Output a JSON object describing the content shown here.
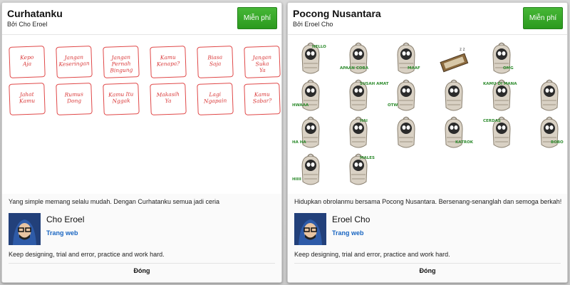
{
  "colors": {
    "accent_green": "#2fa022",
    "link_blue": "#1a66c2",
    "sticker_red": "#d93636",
    "pocong_green": "#2d8b2d"
  },
  "left": {
    "title": "Curhatanku",
    "by": "Bởi Cho Eroel",
    "button": "Miễn phí",
    "stickers": [
      "Kepo\nAja",
      "Jangan\nKeseringan",
      "Jangan\nPernah\nBingung",
      "Kamu\nKenapa?",
      "Biasa\nSaja",
      "Jangan\nSuka\nYa",
      "Jahat\nKamu",
      "Rumus\nDong",
      "Kamu Itu\nNggak",
      "Makasih\nYa",
      "Lagi\nNgapain",
      "Kamu\nSabar?"
    ],
    "description": "Yang simple memang selalu mudah. Dengan Curhatanku semua jadi ceria",
    "author": "Cho Eroel",
    "web": "Trang web",
    "motto": "Keep designing, trial and error, practice and work hard.",
    "close": "Đóng"
  },
  "right": {
    "title": "Pocong Nusantara",
    "by": "Bởi Eroel Cho",
    "button": "Miễn phí",
    "stickers": [
      "HELLO",
      "APAAN COBA",
      "MAAF",
      "",
      "OMG",
      "HWAAA",
      "SUSAH AMAT",
      "OTW",
      "",
      "KAMU DI MANA",
      "",
      "HA HA",
      "HAI",
      "",
      "KATROK",
      "CERDAS",
      "BOBO",
      "HIIII",
      "MALES"
    ],
    "description": "Hidupkan obrolanmu bersama Pocong Nusantara. Bersenang-senanglah dan semoga berkah!",
    "author": "Eroel Cho",
    "web": "Trang web",
    "motto": "Keep designing, trial and error, practice and work hard.",
    "close": "Đóng"
  }
}
